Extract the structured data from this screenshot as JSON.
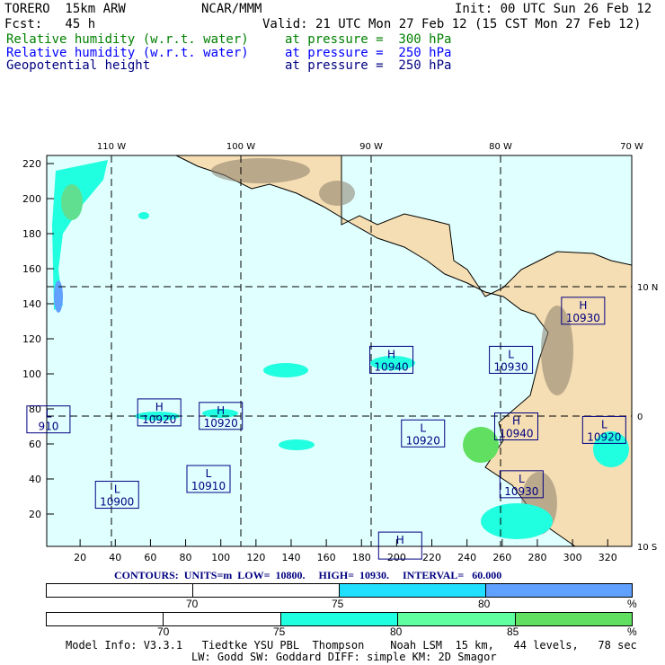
{
  "header": {
    "model": "TORERO  15km ARW",
    "org": "NCAR/MMM",
    "init": "Init: 00 UTC Sun 26 Feb 12",
    "fcst": "Fcst:   45 h",
    "valid": "Valid: 21 UTC Mon 27 Feb 12 (15 CST Mon 27 Feb 12)",
    "fields": [
      {
        "name": "Relative humidity (w.r.t. water)",
        "level": "at pressure =  300 hPa",
        "color": "#008000"
      },
      {
        "name": "Relative humidity (w.r.t. water)",
        "level": "at pressure =  250 hPa",
        "color": "#0000ff"
      },
      {
        "name": "Geopotential height",
        "level": "at pressure =  250 hPa",
        "color": "#000080"
      }
    ]
  },
  "chart_data": {
    "type": "heatmap",
    "top_ticks": [
      "110 W",
      "100 W",
      "90 W",
      "80 W",
      "70 W"
    ],
    "right_ticks": [
      "10 N",
      "0",
      "10 S"
    ],
    "x_ticks": [
      "20",
      "40",
      "60",
      "80",
      "100",
      "120",
      "140",
      "160",
      "180",
      "200",
      "220",
      "240",
      "260",
      "280",
      "300",
      "320"
    ],
    "y_ticks": [
      "20",
      "40",
      "60",
      "80",
      "100",
      "120",
      "140",
      "160",
      "180",
      "200",
      "220"
    ],
    "xlim": [
      0,
      334
    ],
    "ylim": [
      0,
      224
    ],
    "centers": [
      {
        "type": "H",
        "value": "10920",
        "x": 65,
        "y": 78
      },
      {
        "type": "H",
        "value": "10920",
        "x": 100,
        "y": 76
      },
      {
        "type": "L",
        "value": "10910",
        "x": 93,
        "y": 40
      },
      {
        "type": "L",
        "value": "10900",
        "x": 41,
        "y": 31
      },
      {
        "type": "L",
        "value": "910",
        "x": 2,
        "y": 74
      },
      {
        "type": "H",
        "value": "10940",
        "x": 197,
        "y": 108
      },
      {
        "type": "L",
        "value": "10930",
        "x": 265,
        "y": 108
      },
      {
        "type": "H",
        "value": "10930",
        "x": 306,
        "y": 136
      },
      {
        "type": "L",
        "value": "10920",
        "x": 215,
        "y": 66
      },
      {
        "type": "H",
        "value": "10940",
        "x": 268,
        "y": 70
      },
      {
        "type": "L",
        "value": "10930",
        "x": 271,
        "y": 37
      },
      {
        "type": "L",
        "value": "10920",
        "x": 318,
        "y": 68
      },
      {
        "type": "H",
        "value": "",
        "x": 202,
        "y": 2
      }
    ]
  },
  "contours": "CONTOURS:  UNITS=m  LOW=  10800.     HIGH=  10930.     INTERVAL=   60.000",
  "colorbar1": {
    "ticks": [
      "70",
      "75",
      "80"
    ],
    "unit": "%",
    "colors": [
      "#ffffff",
      "#ffffff",
      "#20dfff",
      "#60a0ff"
    ]
  },
  "colorbar2": {
    "ticks": [
      "70",
      "75",
      "80",
      "85"
    ],
    "unit": "%",
    "colors": [
      "#ffffff",
      "#ffffff",
      "#20ffdf",
      "#60ff9f",
      "#60df60"
    ]
  },
  "footer": {
    "line1": "Model Info: V3.3.1   Tiedtke YSU PBL  Thompson    Noah LSM  15 km,   44 levels,   78 sec",
    "line2": "LW: Godd SW: Goddard DIFF: simple KM: 2D Smagor"
  }
}
